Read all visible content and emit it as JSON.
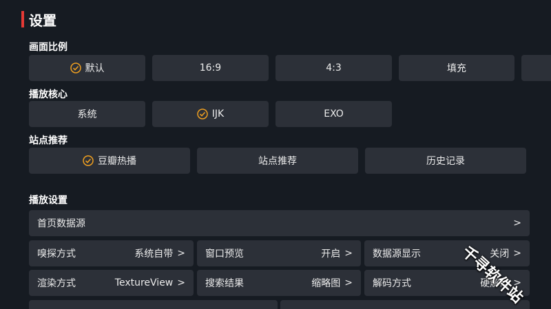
{
  "header": {
    "title": "设置"
  },
  "aspect": {
    "label": "画面比例",
    "options": [
      "默认",
      "16:9",
      "4:3",
      "填充"
    ]
  },
  "core": {
    "label": "播放核心",
    "options": [
      "系统",
      "IJK",
      "EXO"
    ]
  },
  "site": {
    "label": "站点推荐",
    "options": [
      "豆瓣热播",
      "站点推荐",
      "历史记录"
    ]
  },
  "playback": {
    "label": "播放设置",
    "home_source": "首页数据源",
    "rows": [
      {
        "label": "嗅探方式",
        "value": "系统自带"
      },
      {
        "label": "窗口预览",
        "value": "开启"
      },
      {
        "label": "数据源显示",
        "value": "关闭"
      },
      {
        "label": "渲染方式",
        "value": "TextureView"
      },
      {
        "label": "搜索结果",
        "value": "缩略图"
      },
      {
        "label": "解码方式",
        "value": "硬解码"
      }
    ]
  },
  "watermark": "千寻软件站",
  "colors": {
    "accent": "#e53935",
    "check": "#f0a020",
    "button_bg": "#2c3038",
    "page_bg": "#161b22"
  },
  "icons": {
    "selected": "check-circle-icon",
    "chevron": "chevron-right-icon"
  }
}
